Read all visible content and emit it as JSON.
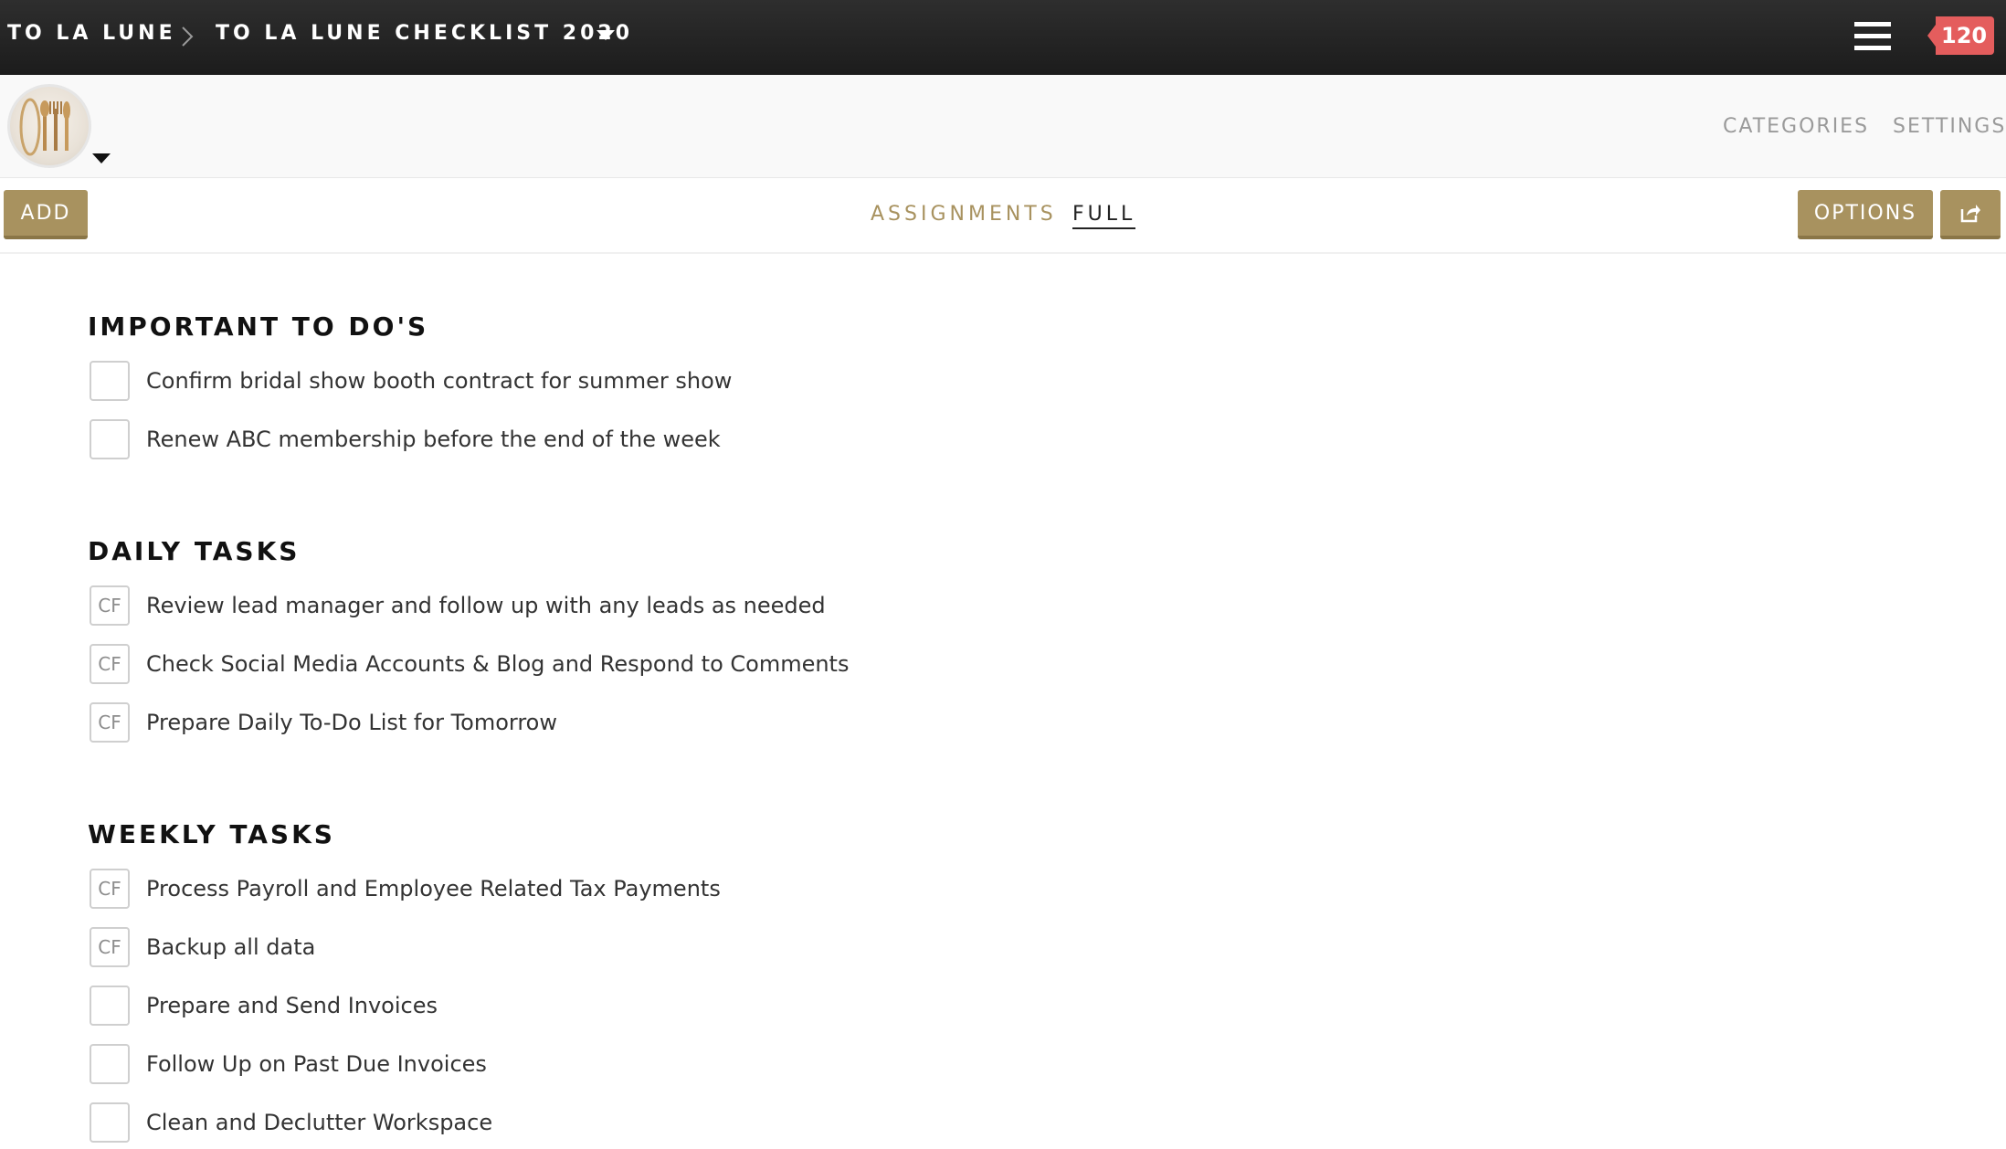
{
  "header": {
    "breadcrumb_root": "TO LA LUNE",
    "breadcrumb_current": "TO LA LUNE CHECKLIST 2020",
    "notification_count": "120"
  },
  "subheader": {
    "categories": "CATEGORIES",
    "settings": "SETTINGS"
  },
  "toolbar": {
    "add_label": "ADD",
    "tab_assignments": "ASSIGNMENTS",
    "tab_full": "FULL",
    "options_label": "OPTIONS"
  },
  "sections": [
    {
      "title": "IMPORTANT TO DO'S",
      "tasks": [
        {
          "marker": "",
          "label": "Confirm bridal show booth contract for summer show"
        },
        {
          "marker": "",
          "label": "Renew ABC membership before the end of the week"
        }
      ]
    },
    {
      "title": "DAILY TASKS",
      "tasks": [
        {
          "marker": "CF",
          "label": "Review lead manager and follow up with any leads as needed"
        },
        {
          "marker": "CF",
          "label": "Check Social Media Accounts & Blog and Respond to Comments"
        },
        {
          "marker": "CF",
          "label": "Prepare Daily To-Do List for Tomorrow"
        }
      ]
    },
    {
      "title": "WEEKLY TASKS",
      "tasks": [
        {
          "marker": "CF",
          "label": "Process Payroll and Employee Related Tax Payments"
        },
        {
          "marker": "CF",
          "label": "Backup all data"
        },
        {
          "marker": "",
          "label": "Prepare and Send Invoices"
        },
        {
          "marker": "",
          "label": "Follow Up on Past Due Invoices"
        },
        {
          "marker": "",
          "label": "Clean and Declutter Workspace"
        }
      ]
    }
  ],
  "colors": {
    "accent_gold": "#a8925f",
    "badge_red": "#e45d5d",
    "topbar": "#232323"
  },
  "icons": {
    "menu": "hamburger-icon",
    "share": "share-icon",
    "caret": "caret-down-icon",
    "breadcrumb_separator": "chevron-right-icon"
  }
}
